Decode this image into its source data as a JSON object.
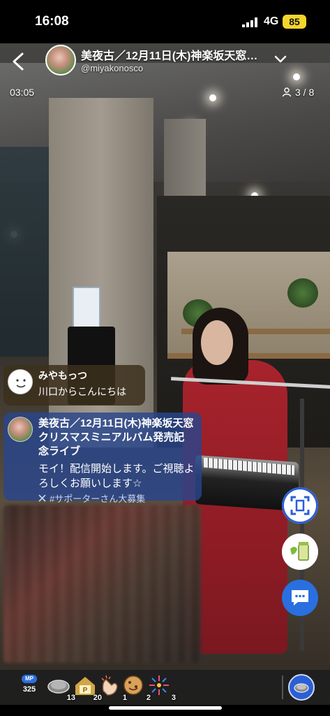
{
  "status_bar": {
    "time": "16:08",
    "network": "4G",
    "battery": "85"
  },
  "header": {
    "title": "美夜古／12月11日(木)神楽坂天窓…",
    "handle": "@miyakonosco"
  },
  "stream": {
    "elapsed": "03:05",
    "viewers": "3 / 8"
  },
  "comments": [
    {
      "name": "みやもっつ",
      "text": "川口からこんにちは"
    },
    {
      "name": "美夜古／12月11日(木)神楽坂天窓クリスマスミニアルバム発売記念ライブ",
      "text": "モイ！配信開始します。ご視聴よろしくお願いします☆",
      "hashtag": "#サポーターさん大募集"
    }
  ],
  "right_actions": [
    {
      "icon": "capture-icon"
    },
    {
      "icon": "drink-gift-icon"
    },
    {
      "icon": "comment-icon"
    }
  ],
  "gift_bar": {
    "mp": {
      "label": "MP",
      "value": "325"
    },
    "items": [
      {
        "icon": "coin-gift-icon",
        "count": "13"
      },
      {
        "icon": "p-house-gift-icon",
        "count": "20"
      },
      {
        "icon": "clap-gift-icon",
        "count": "1"
      },
      {
        "icon": "cookie-gift-icon",
        "count": "2"
      },
      {
        "icon": "fireworks-gift-icon",
        "count": "3"
      }
    ]
  }
}
